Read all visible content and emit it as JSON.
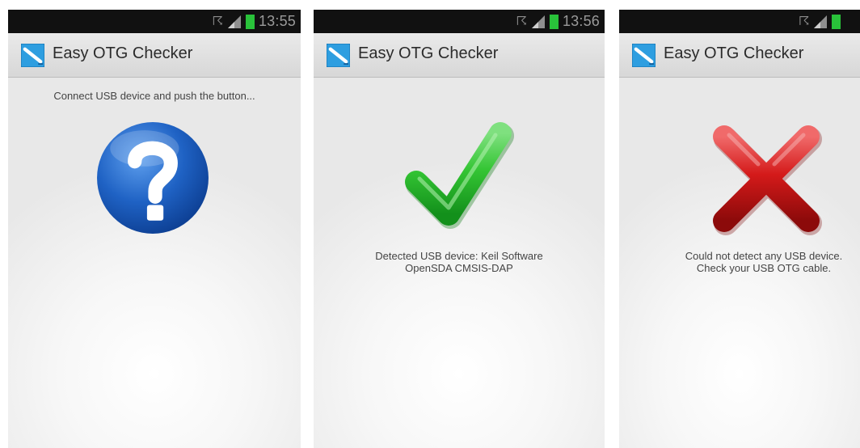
{
  "screens": [
    {
      "status_bar": {
        "time": "13:55"
      },
      "action_bar": {
        "title": "Easy OTG Checker"
      },
      "message": "Connect USB device and push the button..."
    },
    {
      "status_bar": {
        "time": "13:56"
      },
      "action_bar": {
        "title": "Easy OTG Checker"
      },
      "message_line1": "Detected USB device: Keil Software",
      "message_line2": "OpenSDA CMSIS-DAP"
    },
    {
      "action_bar": {
        "title": "Easy OTG Checker"
      },
      "message_line1": "Could not detect any USB device.",
      "message_line2": "Check your USB OTG cable."
    }
  ],
  "icons": {
    "status": [
      "usb-icon",
      "signal-icon",
      "battery-icon"
    ],
    "app": "easy-otg-checker-icon",
    "results": [
      "question-mark-icon",
      "check-mark-icon",
      "cross-icon"
    ]
  },
  "colors": {
    "status_bar": "#111111",
    "action_bar": "#dedede",
    "battery": "#29c23a",
    "question_blue": "#1f62c4",
    "check_green": "#34c534",
    "cross_red": "#d41a1a"
  }
}
